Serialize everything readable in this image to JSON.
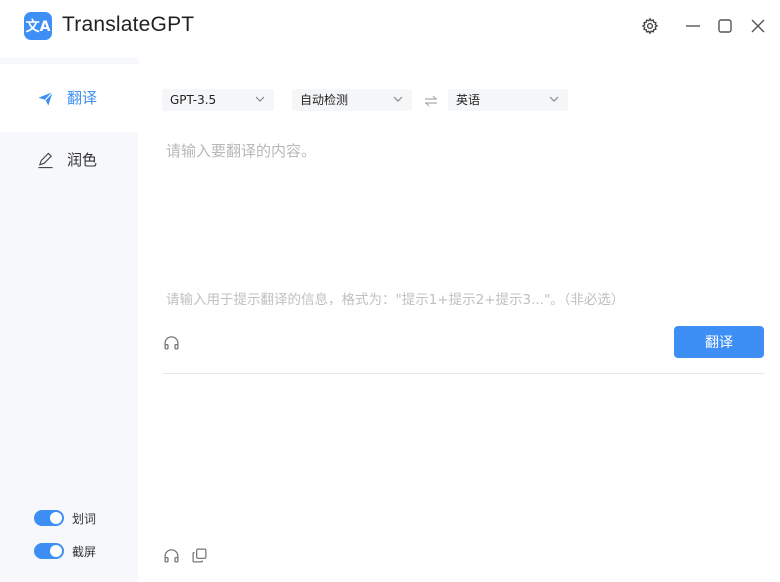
{
  "app": {
    "title": "TranslateGPT",
    "logo_text": "文A",
    "accent": "#3d8ff5"
  },
  "window_controls": {
    "settings": "gear-icon",
    "minimize": "minimize-icon",
    "maximize": "maximize-icon",
    "close": "close-icon"
  },
  "sidebar": {
    "items": [
      {
        "label": "翻译",
        "icon": "paper-plane-icon",
        "active": true
      },
      {
        "label": "润色",
        "icon": "pencil-icon",
        "active": false
      }
    ],
    "toggles": [
      {
        "label": "划词",
        "on": true
      },
      {
        "label": "截屏",
        "on": true
      }
    ]
  },
  "toolbar": {
    "model": "GPT-3.5",
    "source_lang": "自动检测",
    "target_lang": "英语"
  },
  "editor": {
    "placeholder": "请输入要翻译的内容。",
    "hint_placeholder": "请输入用于提示翻译的信息，格式为：\"提示1+提示2+提示3...\"。（非必选）",
    "translate_label": "翻译"
  }
}
